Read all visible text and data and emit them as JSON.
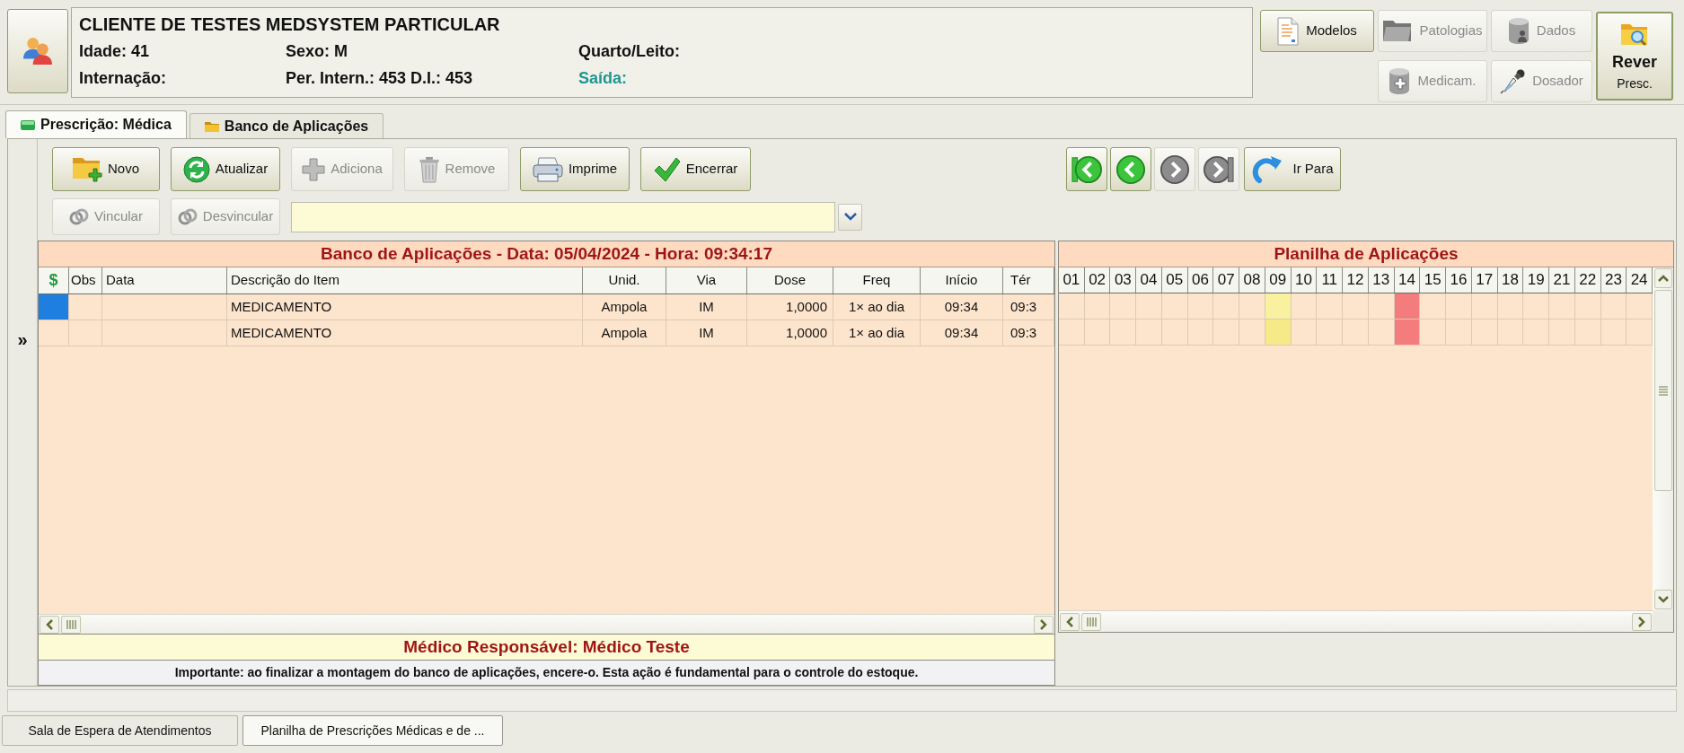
{
  "patient": {
    "title": "CLIENTE DE TESTES MEDSYSTEM PARTICULAR",
    "fields": [
      {
        "text": "Idade: 41",
        "kind": "plain"
      },
      {
        "text": "Sexo: M",
        "kind": "plain"
      },
      {
        "text": "Quarto/Leito:",
        "kind": "plain"
      },
      {
        "text": "Internação:",
        "kind": "plain"
      },
      {
        "text": "Per. Intern.: 453 D.I.: 453",
        "kind": "plain"
      },
      {
        "text": "Saída:",
        "kind": "accent"
      }
    ]
  },
  "header_buttons": [
    {
      "label": "Modelos",
      "disabled": false
    },
    {
      "label": "Patologias",
      "disabled": true
    },
    {
      "label": "Dados",
      "disabled": true
    },
    {
      "label": "Medicam.",
      "disabled": true
    },
    {
      "label": "Dosador",
      "disabled": true
    }
  ],
  "review_button": {
    "label": "Rever",
    "sublabel": "Presc."
  },
  "tabs": [
    {
      "label": "Prescrição: Médica",
      "selected": true
    },
    {
      "label": "Banco de Aplicações",
      "selected": false
    }
  ],
  "side_toggle": "»",
  "toolbar": {
    "row_1": [
      {
        "label": "Novo",
        "disabled": false
      },
      {
        "label": "Atualizar",
        "disabled": false
      },
      {
        "label": "Adiciona",
        "disabled": true
      },
      {
        "label": "Remove",
        "disabled": true
      },
      {
        "label": "Imprime",
        "disabled": false
      },
      {
        "label": "Encerrar",
        "disabled": false
      }
    ],
    "row_2": [
      {
        "label": "Vincular",
        "disabled": true
      },
      {
        "label": "Desvincular",
        "disabled": true
      }
    ]
  },
  "bank": {
    "title": "Banco de Aplicações - Data: 05/04/2024 - Hora: 09:34:17",
    "columns": [
      "$",
      "Obs",
      "Data",
      "Descrição do Item",
      "Unid.",
      "Via",
      "Dose",
      "Freq",
      "Início",
      "Tér"
    ],
    "rows": [
      {
        "selected": true,
        "description": "MEDICAMENTO",
        "unit": "Ampola",
        "route": "IM",
        "dose": "1,0000",
        "frequency": "1× ao dia",
        "start": "09:34",
        "column_10": "09:3"
      },
      {
        "selected": false,
        "description": "MEDICAMENTO",
        "unit": "Ampola",
        "route": "IM",
        "dose": "1,0000",
        "frequency": "1× ao dia",
        "start": "09:34",
        "column_10": "09:3"
      }
    ],
    "doctor": "Médico Responsável: Médico Teste",
    "notice": "Importante: ao finalizar a montagem do banco de aplicações, encere-o. Esta ação é fundamental para o controle do estoque."
  },
  "navigation": {
    "buttons": [
      {
        "disabled": false
      },
      {
        "disabled": false
      },
      {
        "disabled": true
      },
      {
        "disabled": true
      }
    ],
    "goto": {
      "label": "Ir Para"
    }
  },
  "sheet": {
    "title": "Planilha de Aplicações",
    "hours": [
      "01",
      "02",
      "03",
      "04",
      "05",
      "06",
      "07",
      "08",
      "09",
      "10",
      "11",
      "12",
      "13",
      "14",
      "15",
      "16",
      "17",
      "18",
      "19",
      "21",
      "22",
      "23",
      "24"
    ],
    "rows": [
      {
        "cells": [
          {
            "marked": false
          },
          {
            "marked": false
          },
          {
            "marked": false
          },
          {
            "marked": false
          },
          {
            "marked": false
          },
          {
            "marked": false
          },
          {
            "marked": false
          },
          {
            "marked": false
          },
          {
            "marked": true,
            "color": "#f9f0a0"
          },
          {
            "marked": false
          },
          {
            "marked": false
          },
          {
            "marked": false
          },
          {
            "marked": false
          },
          {
            "marked": true,
            "color": "#f47c7c"
          },
          {
            "marked": false
          },
          {
            "marked": false
          },
          {
            "marked": false
          },
          {
            "marked": false
          },
          {
            "marked": false
          },
          {
            "marked": false
          },
          {
            "marked": false
          },
          {
            "marked": false
          },
          {
            "marked": false
          }
        ]
      },
      {
        "cells": [
          {
            "marked": false
          },
          {
            "marked": false
          },
          {
            "marked": false
          },
          {
            "marked": false
          },
          {
            "marked": false
          },
          {
            "marked": false
          },
          {
            "marked": false
          },
          {
            "marked": false
          },
          {
            "marked": true,
            "color": "#f6ea88"
          },
          {
            "marked": false
          },
          {
            "marked": false
          },
          {
            "marked": false
          },
          {
            "marked": false
          },
          {
            "marked": true,
            "color": "#f47c7c"
          },
          {
            "marked": false
          },
          {
            "marked": false
          },
          {
            "marked": false
          },
          {
            "marked": false
          },
          {
            "marked": false
          },
          {
            "marked": false
          },
          {
            "marked": false
          },
          {
            "marked": false
          },
          {
            "marked": false
          }
        ]
      }
    ]
  },
  "taskbar": [
    {
      "label": "Sala de Espera de Atendimentos",
      "selected": false
    },
    {
      "label": "Planilha de Prescrições Médicas e de ...",
      "selected": true
    }
  ]
}
